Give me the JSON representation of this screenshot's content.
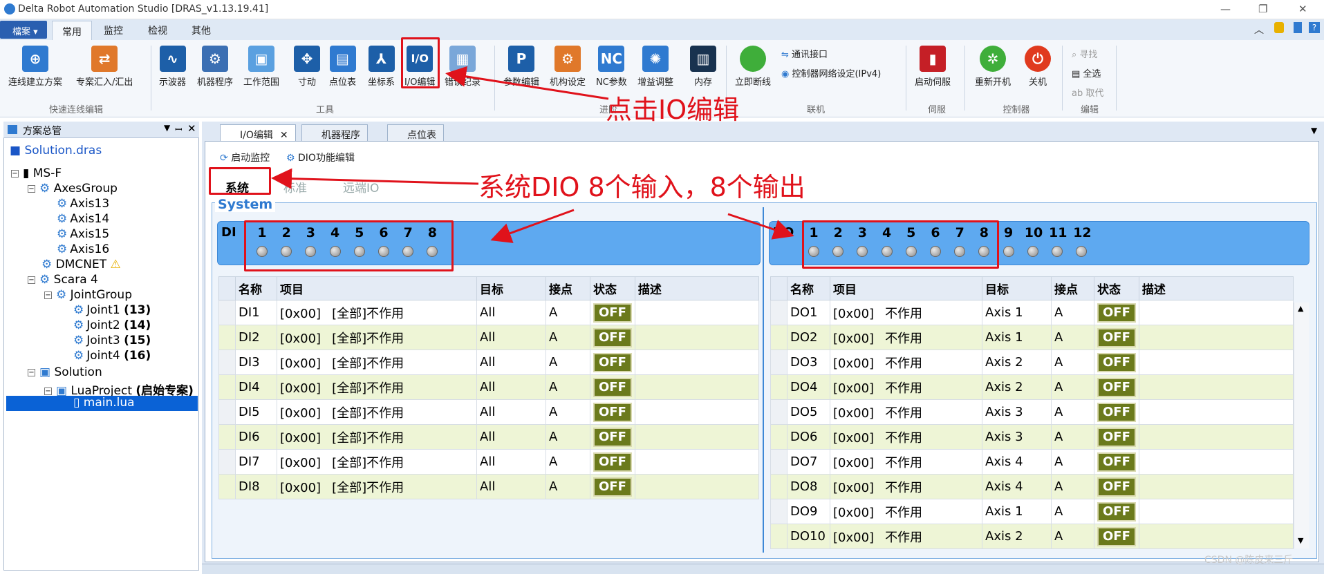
{
  "window": {
    "title": "Delta Robot Automation Studio [DRAS_v1.13.19.41]",
    "controls": [
      "—",
      "❐",
      "✕"
    ]
  },
  "menu": {
    "file_label": "檔案 ▾",
    "tabs": [
      "常用",
      "监控",
      "检视",
      "其他"
    ]
  },
  "ribbon": {
    "quick_group": {
      "label": "快速连线编辑",
      "items": [
        "连线建立方案",
        "专案汇入/汇出"
      ]
    },
    "tools_group": {
      "label": "工具",
      "items": [
        "示波器",
        "机器程序",
        "工作范围",
        "寸动",
        "点位表",
        "坐标系",
        "I/O编辑",
        "错误纪录"
      ]
    },
    "advanced_group": {
      "label": "进阶",
      "items": [
        "参数编辑",
        "机构设定",
        "NC参数",
        "增益调整",
        "内存"
      ]
    },
    "connect_group": {
      "label": "联机",
      "big": "立即断线",
      "small": [
        "通讯接口",
        "控制器网络设定(IPv4)"
      ]
    },
    "servo_group": {
      "label": "伺服",
      "item": "启动伺服"
    },
    "controller_group": {
      "label": "控制器",
      "items": [
        "重新开机",
        "关机"
      ]
    },
    "edit_group": {
      "label": "编辑",
      "items": [
        "寻找",
        "全选",
        "取代"
      ]
    }
  },
  "annotations": {
    "click_io": "点击IO编辑",
    "dio_note": "系统DIO 8个输入，8个输出"
  },
  "solution_panel": {
    "title": "方案总管",
    "file": "Solution.dras",
    "tree": {
      "root": "MS-F",
      "axes_group": "AxesGroup",
      "axes": [
        "Axis13",
        "Axis14",
        "Axis15",
        "Axis16"
      ],
      "dmcnet": "DMCNET",
      "scara": "Scara 4",
      "joint_group": "JointGroup",
      "joints": [
        {
          "name": "Joint1",
          "num": "(13)"
        },
        {
          "name": "Joint2",
          "num": "(14)"
        },
        {
          "name": "Joint3",
          "num": "(15)"
        },
        {
          "name": "Joint4",
          "num": "(16)"
        }
      ],
      "solution": "Solution",
      "lua_project": "LuaProject",
      "lua_tag": "(启始专案)",
      "main": "main.lua"
    }
  },
  "doc_tabs": [
    "I/O编辑",
    "机器程序",
    "点位表"
  ],
  "toolbar": {
    "start_monitor": "启动监控",
    "dio_edit": "DIO功能编辑"
  },
  "sub_tabs": [
    "系统",
    "标准",
    "远端IO"
  ],
  "system": {
    "label": "System",
    "di_label": "DI",
    "do_label": "DO",
    "di_channels": [
      "1",
      "2",
      "3",
      "4",
      "5",
      "6",
      "7",
      "8"
    ],
    "do_channels": [
      "1",
      "2",
      "3",
      "4",
      "5",
      "6",
      "7",
      "8",
      "9",
      "10",
      "11",
      "12"
    ]
  },
  "columns": [
    "名称",
    "项目",
    "目标",
    "接点",
    "状态",
    "描述"
  ],
  "di_rows": [
    {
      "name": "DI1",
      "addr": "[0x00]",
      "item": "[全部]不作用",
      "target": "All",
      "contact": "A",
      "status": "OFF"
    },
    {
      "name": "DI2",
      "addr": "[0x00]",
      "item": "[全部]不作用",
      "target": "All",
      "contact": "A",
      "status": "OFF"
    },
    {
      "name": "DI3",
      "addr": "[0x00]",
      "item": "[全部]不作用",
      "target": "All",
      "contact": "A",
      "status": "OFF"
    },
    {
      "name": "DI4",
      "addr": "[0x00]",
      "item": "[全部]不作用",
      "target": "All",
      "contact": "A",
      "status": "OFF"
    },
    {
      "name": "DI5",
      "addr": "[0x00]",
      "item": "[全部]不作用",
      "target": "All",
      "contact": "A",
      "status": "OFF"
    },
    {
      "name": "DI6",
      "addr": "[0x00]",
      "item": "[全部]不作用",
      "target": "All",
      "contact": "A",
      "status": "OFF"
    },
    {
      "name": "DI7",
      "addr": "[0x00]",
      "item": "[全部]不作用",
      "target": "All",
      "contact": "A",
      "status": "OFF"
    },
    {
      "name": "DI8",
      "addr": "[0x00]",
      "item": "[全部]不作用",
      "target": "All",
      "contact": "A",
      "status": "OFF"
    }
  ],
  "do_rows": [
    {
      "name": "DO1",
      "addr": "[0x00]",
      "item": "不作用",
      "target": "Axis 1",
      "contact": "A",
      "status": "OFF"
    },
    {
      "name": "DO2",
      "addr": "[0x00]",
      "item": "不作用",
      "target": "Axis 1",
      "contact": "A",
      "status": "OFF"
    },
    {
      "name": "DO3",
      "addr": "[0x00]",
      "item": "不作用",
      "target": "Axis 2",
      "contact": "A",
      "status": "OFF"
    },
    {
      "name": "DO4",
      "addr": "[0x00]",
      "item": "不作用",
      "target": "Axis 2",
      "contact": "A",
      "status": "OFF"
    },
    {
      "name": "DO5",
      "addr": "[0x00]",
      "item": "不作用",
      "target": "Axis 3",
      "contact": "A",
      "status": "OFF"
    },
    {
      "name": "DO6",
      "addr": "[0x00]",
      "item": "不作用",
      "target": "Axis 3",
      "contact": "A",
      "status": "OFF"
    },
    {
      "name": "DO7",
      "addr": "[0x00]",
      "item": "不作用",
      "target": "Axis 4",
      "contact": "A",
      "status": "OFF"
    },
    {
      "name": "DO8",
      "addr": "[0x00]",
      "item": "不作用",
      "target": "Axis 4",
      "contact": "A",
      "status": "OFF"
    },
    {
      "name": "DO9",
      "addr": "[0x00]",
      "item": "不作用",
      "target": "Axis 1",
      "contact": "A",
      "status": "OFF"
    },
    {
      "name": "DO10",
      "addr": "[0x00]",
      "item": "不作用",
      "target": "Axis 2",
      "contact": "A",
      "status": "OFF"
    }
  ],
  "watermark": "CSDN @陈皮来三斤"
}
